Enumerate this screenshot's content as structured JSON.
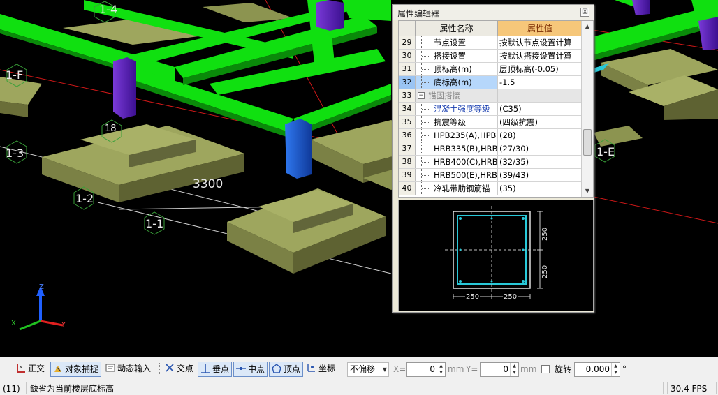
{
  "viewport": {
    "axis_labels": [
      "1-4",
      "1-F",
      "1-3",
      "1-2",
      "1-1",
      "1-E"
    ],
    "dimension_label": "3300",
    "extra_label": "18",
    "fps": "30.4 FPS",
    "axis_gizmo": {
      "z": "Z",
      "x": "X",
      "y": "Y"
    }
  },
  "property_editor": {
    "title": "属性编辑器",
    "close_symbol": "☒",
    "columns": {
      "name": "属性名称",
      "value": "属性值"
    },
    "rows": [
      {
        "num": "29",
        "name": "节点设置",
        "value": "按默认节点设置计算"
      },
      {
        "num": "30",
        "name": "搭接设置",
        "value": "按默认搭接设置计算"
      },
      {
        "num": "31",
        "name": "顶标高(m)",
        "value": "层顶标高(-0.05)"
      },
      {
        "num": "32",
        "name": "底标高(m)",
        "value": "-1.5",
        "selected": true
      },
      {
        "num": "33",
        "name": "锚固搭接",
        "value": "",
        "group": true,
        "expander": "−"
      },
      {
        "num": "34",
        "name": "混凝土强度等级",
        "value": "(C35)",
        "blue": true
      },
      {
        "num": "35",
        "name": "抗震等级",
        "value": "(四级抗震)"
      },
      {
        "num": "36",
        "name": "HPB235(A),HPB3",
        "value": "(28)"
      },
      {
        "num": "37",
        "name": "HRB335(B),HRB3",
        "value": "(27/30)"
      },
      {
        "num": "38",
        "name": "HRB400(C),HRB4",
        "value": "(32/35)"
      },
      {
        "num": "39",
        "name": "HRB500(E),HRB5",
        "value": "(39/43)"
      },
      {
        "num": "40",
        "name": "冷轧带肋钢筋锚",
        "value": "(35)"
      }
    ],
    "section_dims": {
      "h_top": "250",
      "h_bottom": "250",
      "w_left": "250",
      "w_right": "250"
    }
  },
  "toolbar": {
    "ortho": "正交",
    "snap": "对象捕捉",
    "dynamic_input": "动态输入",
    "intersection": "交点",
    "perpendicular": "垂点",
    "midpoint": "中点",
    "vertex": "顶点",
    "coordinate": "坐标",
    "offset_mode": "不偏移",
    "x_label": "X=",
    "x_value": "0",
    "mm1": "mm",
    "y_label": "Y=",
    "y_value": "0",
    "mm2": "mm",
    "rotate_label": "旋转",
    "rotate_value": "0.000",
    "degree": "°"
  },
  "status": {
    "count": "(11)",
    "message": "缺省为当前楼层底标高"
  },
  "colors": {
    "beam": "#10e010",
    "footing": "#9ea65e",
    "column_purple": "#5a1fb0",
    "column_blue": "#1a58c8",
    "axis_red": "#e02020",
    "accent_cyan": "#28c8d8",
    "header_orange": "#f6c77a"
  }
}
